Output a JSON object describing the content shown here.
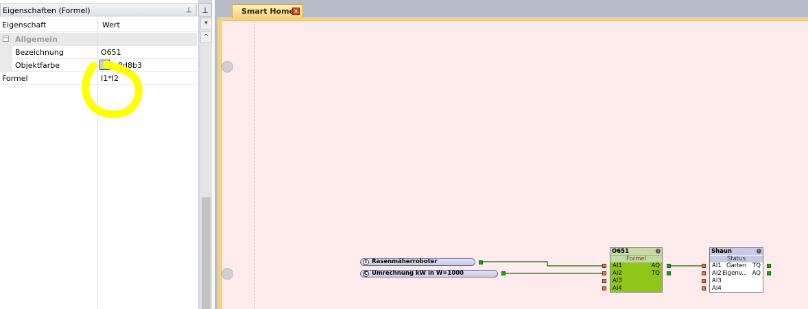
{
  "properties_panel": {
    "title": "Eigenschaften (Formel)",
    "pin_icon": "pin-icon",
    "header": {
      "col_property": "Eigenschaft",
      "col_value": "Wert"
    },
    "category": {
      "expand_symbol": "⊟",
      "label": "Allgemein"
    },
    "rows": [
      {
        "key": "Bezeichnung",
        "value": "O651"
      },
      {
        "key": "Objektfarbe",
        "value": "c8d8b3",
        "swatch_color": "#c8d8b3"
      },
      {
        "key": "Formel",
        "value": "I1*I2"
      }
    ]
  },
  "side_strip": {
    "pin_icon": "pin-icon",
    "dropdown_icon": "▾",
    "scroll_up_icon": "^"
  },
  "document": {
    "tab_label": "Smart Home",
    "tab_close_icon": "close-icon",
    "tab_close_glyph": "x",
    "tab_color": "#f6d27c",
    "canvas_color": "#fdeceb"
  },
  "inputs": [
    {
      "badge": "I",
      "label": "Rasenmäherroboter"
    },
    {
      "badge": "C",
      "label": "Umrechnung kW in W=1000"
    }
  ],
  "block_formula": {
    "title": "O651",
    "subtitle": "Formel",
    "color": "#8fc61a",
    "inputs": [
      "AI1",
      "AI2",
      "AI3",
      "AI4"
    ],
    "outputs": [
      "AQ",
      "TQ"
    ]
  },
  "block_status": {
    "title": "Shaun",
    "subtitle": "Status",
    "inputs": [
      "AI1",
      "AI2",
      "AI3",
      "AI4"
    ],
    "input_labels": [
      "Garten",
      "Eigenv..."
    ],
    "outputs": [
      "TQ",
      "AQ"
    ]
  },
  "colors": {
    "wire": "#1e8c1e",
    "highlight": "#ffff00"
  }
}
